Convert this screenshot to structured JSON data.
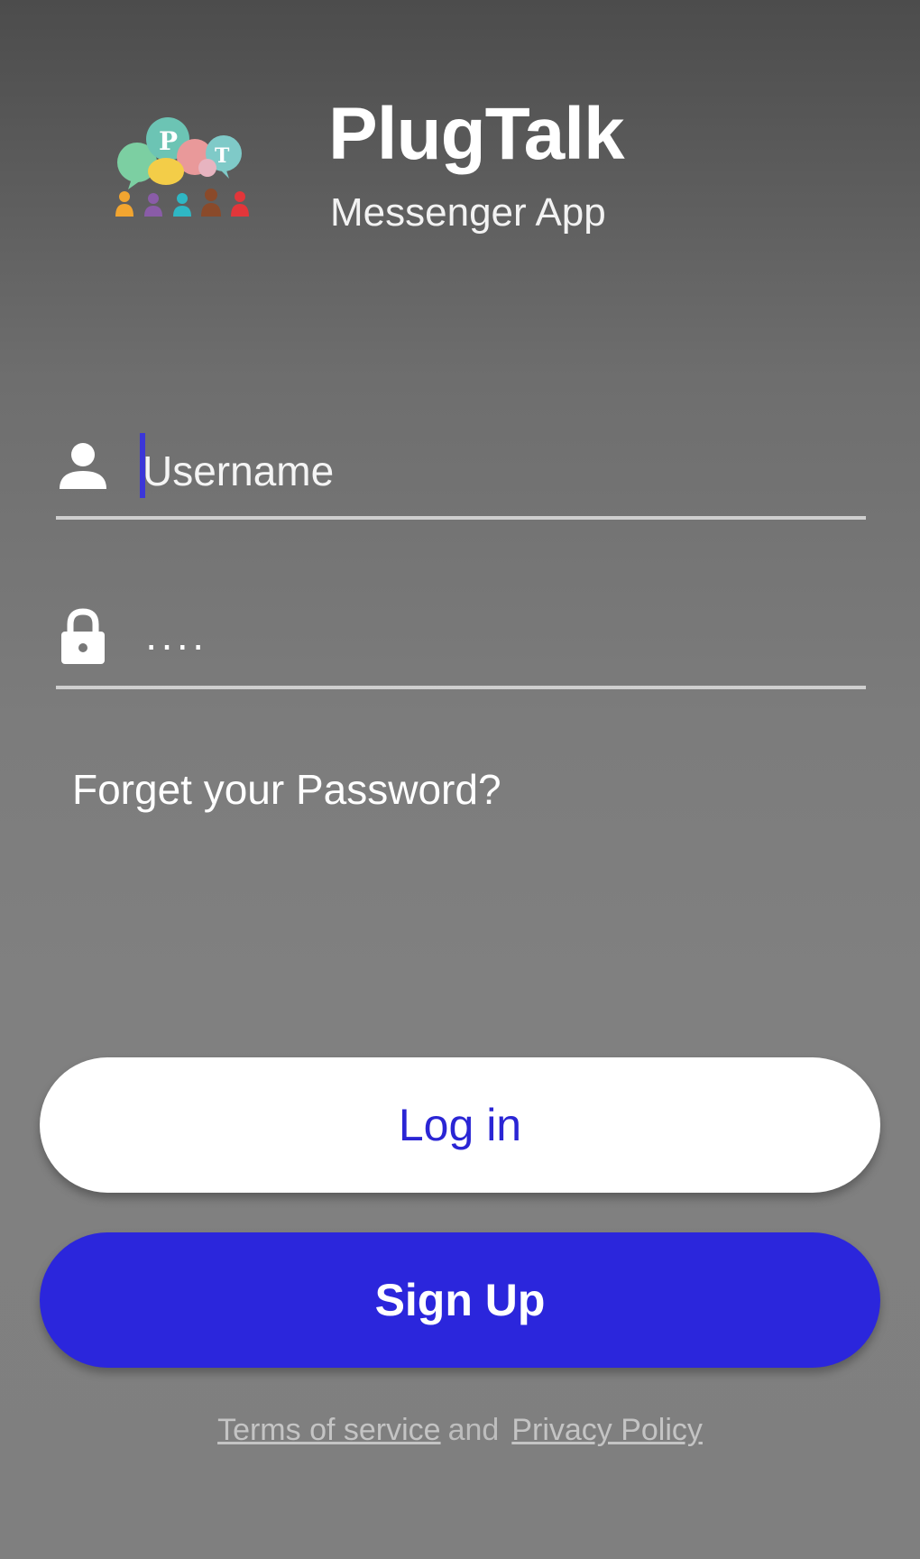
{
  "header": {
    "title": "PlugTalk",
    "subtitle": "Messenger App",
    "logo_icon": "speech-bubbles-people-logo"
  },
  "login_form": {
    "username": {
      "icon": "person-icon",
      "placeholder": "Username",
      "value": ""
    },
    "password": {
      "icon": "lock-icon",
      "masked_value": "····"
    },
    "forgot_password_label": "Forget your Password?"
  },
  "actions": {
    "login_label": "Log in",
    "signup_label": "Sign Up"
  },
  "footer": {
    "terms_label": "Terms of service",
    "conjunction": "and",
    "privacy_label": "Privacy Policy"
  },
  "colors": {
    "accent": "#2b26dc",
    "login_text": "#2a25d4",
    "field_underline": "#cfcfcf",
    "background_top": "#4c4c4c",
    "background_bottom": "#7f7f7f"
  }
}
